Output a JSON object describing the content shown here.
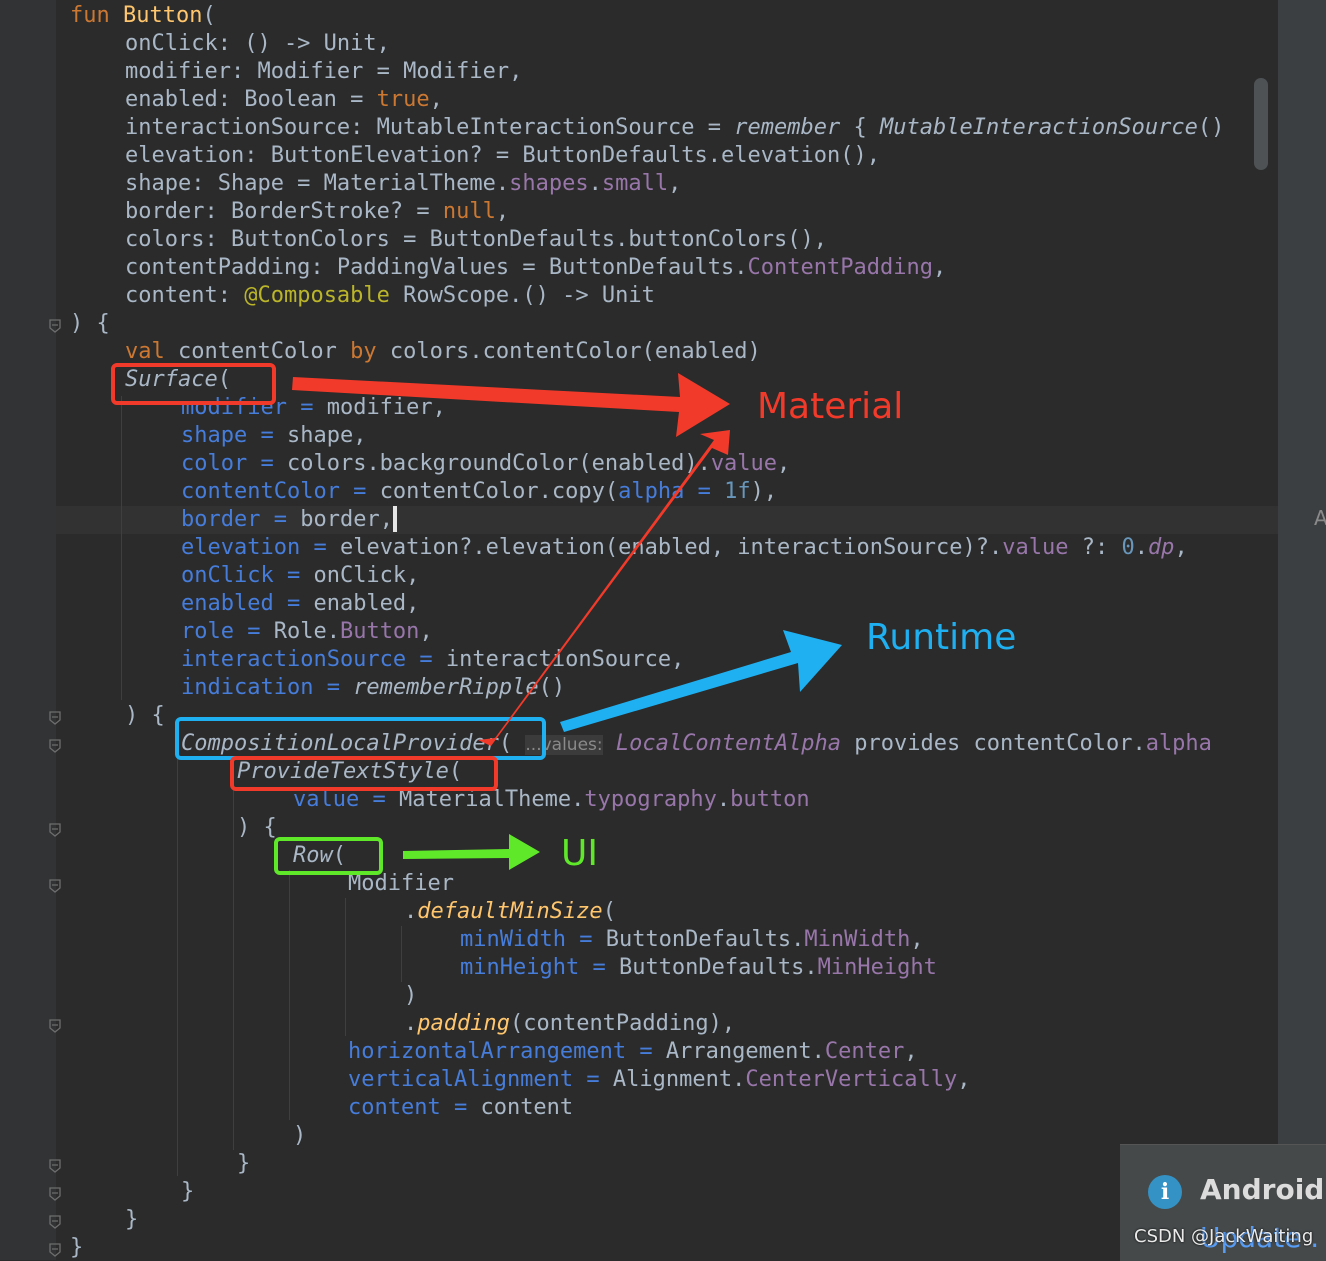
{
  "code_lines": [
    {
      "indent": 5,
      "spans": [
        {
          "c": "kw",
          "t": "fun "
        },
        {
          "c": "fn",
          "t": "Button"
        },
        {
          "c": "t",
          "t": "("
        }
      ]
    },
    {
      "indent": 9,
      "spans": [
        {
          "c": "t",
          "t": "onClick: () -> Unit,"
        }
      ]
    },
    {
      "indent": 9,
      "spans": [
        {
          "c": "t",
          "t": "modifier: Modifier = Modifier,"
        }
      ]
    },
    {
      "indent": 9,
      "spans": [
        {
          "c": "t",
          "t": "enabled: Boolean = "
        },
        {
          "c": "kw",
          "t": "true"
        },
        {
          "c": "t",
          "t": ","
        }
      ]
    },
    {
      "indent": 9,
      "spans": [
        {
          "c": "t",
          "t": "interactionSource: MutableInteractionSource = "
        },
        {
          "c": "t it",
          "t": "remember"
        },
        {
          "c": "t",
          "t": " { "
        },
        {
          "c": "t it",
          "t": "MutableInteractionSource"
        },
        {
          "c": "t",
          "t": "()"
        }
      ]
    },
    {
      "indent": 9,
      "spans": [
        {
          "c": "t",
          "t": "elevation: ButtonElevation? = ButtonDefaults.elevation(),"
        }
      ]
    },
    {
      "indent": 9,
      "spans": [
        {
          "c": "t",
          "t": "shape: Shape = MaterialTheme."
        },
        {
          "c": "prop",
          "t": "shapes"
        },
        {
          "c": "t",
          "t": "."
        },
        {
          "c": "prop",
          "t": "small"
        },
        {
          "c": "t",
          "t": ","
        }
      ]
    },
    {
      "indent": 9,
      "spans": [
        {
          "c": "t",
          "t": "border: BorderStroke? = "
        },
        {
          "c": "kw",
          "t": "null"
        },
        {
          "c": "t",
          "t": ","
        }
      ]
    },
    {
      "indent": 9,
      "spans": [
        {
          "c": "t",
          "t": "colors: ButtonColors = ButtonDefaults.buttonColors(),"
        }
      ]
    },
    {
      "indent": 9,
      "spans": [
        {
          "c": "t",
          "t": "contentPadding: PaddingValues = ButtonDefaults."
        },
        {
          "c": "prop",
          "t": "ContentPadding"
        },
        {
          "c": "t",
          "t": ","
        }
      ]
    },
    {
      "indent": 9,
      "spans": [
        {
          "c": "t",
          "t": "content: "
        },
        {
          "c": "ann",
          "t": "@Composable"
        },
        {
          "c": "t",
          "t": " RowScope.() -> Unit"
        }
      ]
    },
    {
      "indent": 5,
      "spans": [
        {
          "c": "t",
          "t": ") {"
        }
      ]
    },
    {
      "indent": 9,
      "spans": [
        {
          "c": "kw",
          "t": "val "
        },
        {
          "c": "t",
          "t": "contentColor "
        },
        {
          "c": "kw",
          "t": "by "
        },
        {
          "c": "t",
          "t": "colors.contentColor(enabled)"
        }
      ]
    },
    {
      "indent": 9,
      "spans": [
        {
          "c": "t it",
          "t": "Surface"
        },
        {
          "c": "t",
          "t": "("
        }
      ]
    },
    {
      "indent": 13,
      "spans": [
        {
          "c": "param",
          "t": "modifier = "
        },
        {
          "c": "t",
          "t": "modifier,"
        }
      ]
    },
    {
      "indent": 13,
      "spans": [
        {
          "c": "param",
          "t": "shape = "
        },
        {
          "c": "t",
          "t": "shape,"
        }
      ]
    },
    {
      "indent": 13,
      "spans": [
        {
          "c": "param",
          "t": "color = "
        },
        {
          "c": "t",
          "t": "colors.backgroundColor(enabled)."
        },
        {
          "c": "prop",
          "t": "value"
        },
        {
          "c": "t",
          "t": ","
        }
      ]
    },
    {
      "indent": 13,
      "spans": [
        {
          "c": "param",
          "t": "contentColor = "
        },
        {
          "c": "t",
          "t": "contentColor.copy("
        },
        {
          "c": "param",
          "t": "alpha = "
        },
        {
          "c": "num",
          "t": "1f"
        },
        {
          "c": "t",
          "t": "),"
        }
      ]
    },
    {
      "indent": 13,
      "spans": [
        {
          "c": "param",
          "t": "border = "
        },
        {
          "c": "t",
          "t": "border,"
        }
      ],
      "caret": true
    },
    {
      "indent": 13,
      "spans": [
        {
          "c": "param",
          "t": "elevation = "
        },
        {
          "c": "t",
          "t": "elevation?.elevation(enabled, interactionSource)?."
        },
        {
          "c": "prop",
          "t": "value"
        },
        {
          "c": "t",
          "t": " ?: "
        },
        {
          "c": "num",
          "t": "0"
        },
        {
          "c": "t",
          "t": "."
        },
        {
          "c": "prop it",
          "t": "dp"
        },
        {
          "c": "t",
          "t": ","
        }
      ]
    },
    {
      "indent": 13,
      "spans": [
        {
          "c": "param",
          "t": "onClick = "
        },
        {
          "c": "t",
          "t": "onClick,"
        }
      ]
    },
    {
      "indent": 13,
      "spans": [
        {
          "c": "param",
          "t": "enabled = "
        },
        {
          "c": "t",
          "t": "enabled,"
        }
      ]
    },
    {
      "indent": 13,
      "spans": [
        {
          "c": "param",
          "t": "role = "
        },
        {
          "c": "t",
          "t": "Role."
        },
        {
          "c": "prop",
          "t": "Button"
        },
        {
          "c": "t",
          "t": ","
        }
      ]
    },
    {
      "indent": 13,
      "spans": [
        {
          "c": "param",
          "t": "interactionSource = "
        },
        {
          "c": "t",
          "t": "interactionSource,"
        }
      ]
    },
    {
      "indent": 13,
      "spans": [
        {
          "c": "param",
          "t": "indication = "
        },
        {
          "c": "t it",
          "t": "rememberRipple"
        },
        {
          "c": "t",
          "t": "()"
        }
      ]
    },
    {
      "indent": 9,
      "spans": [
        {
          "c": "t",
          "t": ") {"
        }
      ]
    },
    {
      "indent": 13,
      "spans": [
        {
          "c": "t it",
          "t": "CompositionLocalProvider"
        },
        {
          "c": "t",
          "t": "( "
        },
        {
          "c": "hint",
          "t": "...values:"
        },
        {
          "c": "t",
          "t": " "
        },
        {
          "c": "prop it",
          "t": "LocalContentAlpha"
        },
        {
          "c": "t",
          "t": " provides contentColor."
        },
        {
          "c": "prop",
          "t": "alpha"
        }
      ]
    },
    {
      "indent": 17,
      "spans": [
        {
          "c": "t it",
          "t": "ProvideTextStyle"
        },
        {
          "c": "t",
          "t": "("
        }
      ]
    },
    {
      "indent": 21,
      "spans": [
        {
          "c": "param",
          "t": "value = "
        },
        {
          "c": "t",
          "t": "MaterialTheme."
        },
        {
          "c": "prop",
          "t": "typography"
        },
        {
          "c": "t",
          "t": "."
        },
        {
          "c": "prop",
          "t": "button"
        }
      ]
    },
    {
      "indent": 17,
      "spans": [
        {
          "c": "t",
          "t": ") {"
        }
      ]
    },
    {
      "indent": 21,
      "spans": [
        {
          "c": "t it",
          "t": "Row"
        },
        {
          "c": "t",
          "t": "("
        }
      ]
    },
    {
      "indent": 25,
      "spans": [
        {
          "c": "t",
          "t": "Modifier"
        }
      ]
    },
    {
      "indent": 29,
      "spans": [
        {
          "c": "t",
          "t": "."
        },
        {
          "c": "itfn",
          "t": "defaultMinSize"
        },
        {
          "c": "t",
          "t": "("
        }
      ]
    },
    {
      "indent": 33,
      "spans": [
        {
          "c": "param",
          "t": "minWidth = "
        },
        {
          "c": "t",
          "t": "ButtonDefaults."
        },
        {
          "c": "prop",
          "t": "MinWidth"
        },
        {
          "c": "t",
          "t": ","
        }
      ]
    },
    {
      "indent": 33,
      "spans": [
        {
          "c": "param",
          "t": "minHeight = "
        },
        {
          "c": "t",
          "t": "ButtonDefaults."
        },
        {
          "c": "prop",
          "t": "MinHeight"
        }
      ]
    },
    {
      "indent": 29,
      "spans": [
        {
          "c": "t",
          "t": ")"
        }
      ]
    },
    {
      "indent": 29,
      "spans": [
        {
          "c": "t",
          "t": "."
        },
        {
          "c": "itfn",
          "t": "padding"
        },
        {
          "c": "t",
          "t": "(contentPadding),"
        }
      ]
    },
    {
      "indent": 25,
      "spans": [
        {
          "c": "param",
          "t": "horizontalArrangement = "
        },
        {
          "c": "t",
          "t": "Arrangement."
        },
        {
          "c": "prop",
          "t": "Center"
        },
        {
          "c": "t",
          "t": ","
        }
      ]
    },
    {
      "indent": 25,
      "spans": [
        {
          "c": "param",
          "t": "verticalAlignment = "
        },
        {
          "c": "t",
          "t": "Alignment."
        },
        {
          "c": "prop",
          "t": "CenterVertically"
        },
        {
          "c": "t",
          "t": ","
        }
      ]
    },
    {
      "indent": 25,
      "spans": [
        {
          "c": "param",
          "t": "content = "
        },
        {
          "c": "t",
          "t": "content"
        }
      ]
    },
    {
      "indent": 21,
      "spans": [
        {
          "c": "t",
          "t": ")"
        }
      ]
    },
    {
      "indent": 17,
      "spans": [
        {
          "c": "t",
          "t": "}"
        }
      ]
    },
    {
      "indent": 13,
      "spans": [
        {
          "c": "t",
          "t": "}"
        }
      ]
    },
    {
      "indent": 9,
      "spans": [
        {
          "c": "t",
          "t": "}"
        }
      ]
    },
    {
      "indent": 5,
      "spans": [
        {
          "c": "t",
          "t": "}"
        }
      ]
    }
  ],
  "annotations": {
    "material_label": "Material",
    "runtime_label": "Runtime",
    "ui_label": "UI",
    "material_color": "#f23a2a",
    "runtime_color": "#1fb0f2",
    "ui_color": "#5fe82a"
  },
  "notification": {
    "icon": "info-icon",
    "icon_glyph": "i",
    "title": "Android",
    "link": "Update ."
  },
  "right_strip_letter": "A",
  "watermark": "CSDN @JackWaiting"
}
